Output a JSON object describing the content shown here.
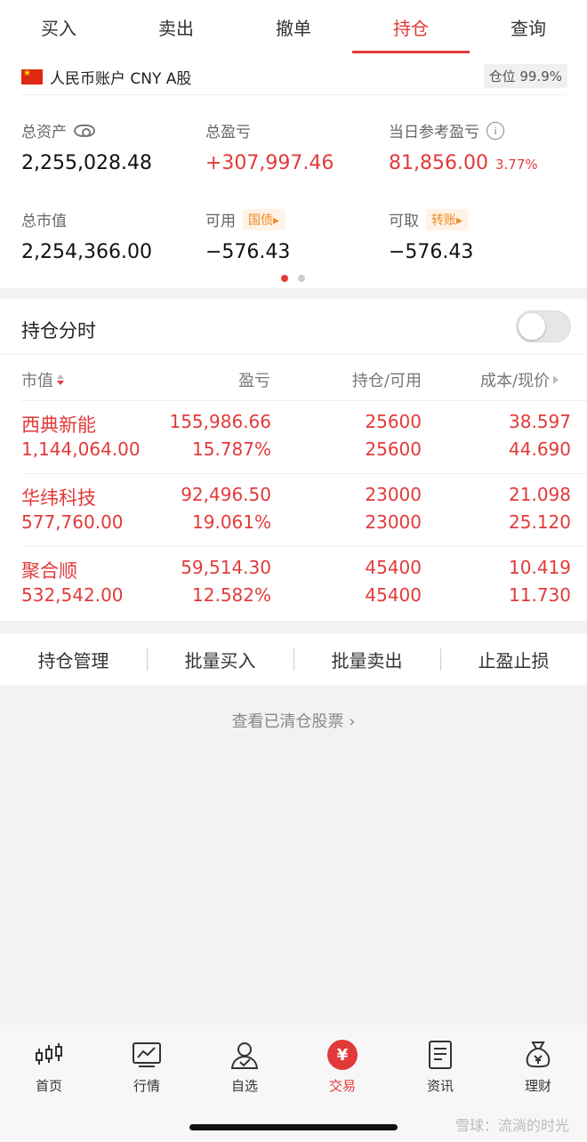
{
  "tabs": [
    {
      "label": "买入",
      "active": false
    },
    {
      "label": "卖出",
      "active": false
    },
    {
      "label": "撤单",
      "active": false
    },
    {
      "label": "持仓",
      "active": true
    },
    {
      "label": "查询",
      "active": false
    }
  ],
  "account": {
    "name": "人民币账户 CNY A股",
    "position_label": "仓位 99.9%"
  },
  "metrics": {
    "total_assets": {
      "label": "总资产",
      "value": "2,255,028.48"
    },
    "total_pnl": {
      "label": "总盈亏",
      "value": "+307,997.46"
    },
    "day_pnl": {
      "label": "当日参考盈亏",
      "value": "81,856.00",
      "pct": "3.77%"
    },
    "market_value": {
      "label": "总市值",
      "value": "2,254,366.00"
    },
    "available": {
      "label": "可用",
      "chip": "国债",
      "value": "−576.43"
    },
    "withdrawable": {
      "label": "可取",
      "chip": "转账",
      "value": "−576.43"
    }
  },
  "holdings": {
    "title": "持仓分时",
    "toggle_on": false,
    "columns": [
      "市值",
      "盈亏",
      "持仓/可用",
      "成本/现价"
    ],
    "rows": [
      {
        "name": "西典新能",
        "market_value": "1,144,064.00",
        "pnl": "155,986.66",
        "pnl_pct": "15.787%",
        "position": "25600",
        "available": "25600",
        "cost": "38.597",
        "price": "44.690"
      },
      {
        "name": "华纬科技",
        "market_value": "577,760.00",
        "pnl": "92,496.50",
        "pnl_pct": "19.061%",
        "position": "23000",
        "available": "23000",
        "cost": "21.098",
        "price": "25.120"
      },
      {
        "name": "聚合顺",
        "market_value": "532,542.00",
        "pnl": "59,514.30",
        "pnl_pct": "12.582%",
        "position": "45400",
        "available": "45400",
        "cost": "10.419",
        "price": "11.730"
      }
    ]
  },
  "actions": [
    "持仓管理",
    "批量买入",
    "批量卖出",
    "止盈止损"
  ],
  "cleared_link": "查看已清仓股票 ›",
  "bottom_nav": [
    {
      "label": "首页",
      "icon": "candlestick-icon"
    },
    {
      "label": "行情",
      "icon": "chart-icon"
    },
    {
      "label": "自选",
      "icon": "user-check-icon"
    },
    {
      "label": "交易",
      "icon": "yuan-coin-icon",
      "active": true
    },
    {
      "label": "资讯",
      "icon": "document-icon"
    },
    {
      "label": "理财",
      "icon": "money-bag-icon"
    }
  ],
  "watermark": "雪球：流淌的时光",
  "colors": {
    "accent": "#e23a3a",
    "chip": "#f08a24"
  }
}
